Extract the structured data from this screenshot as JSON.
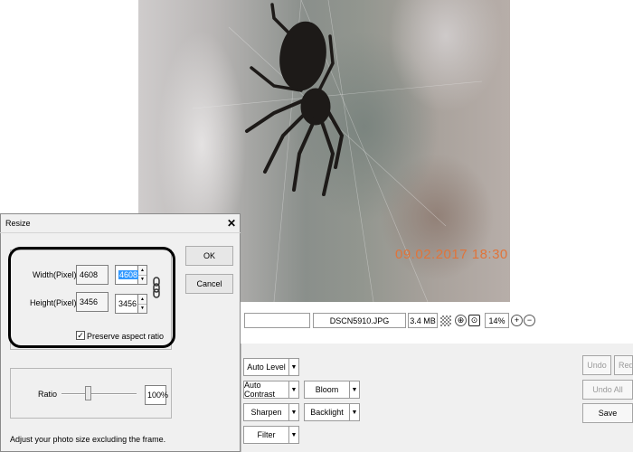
{
  "photo": {
    "date_stamp": "09.02.2017 18:30"
  },
  "status_bar": {
    "file_name": "DSCN5910.JPG",
    "file_size": "3.4 MB",
    "zoom": "14%"
  },
  "tools": {
    "auto_level": "Auto Level",
    "auto_contrast": "Auto Contrast",
    "sharpen": "Sharpen",
    "filter": "Filter",
    "bloom": "Bloom",
    "backlight": "Backlight",
    "undo": "Undo",
    "redo": "Redo",
    "undo_all": "Undo All",
    "save": "Save"
  },
  "dialog": {
    "title": "Resize",
    "width_label": "Width(Pixel)",
    "height_label": "Height(Pixel)",
    "orig_width": "4608",
    "orig_height": "3456",
    "new_width": "4608",
    "new_height": "3456",
    "preserve_label": "Preserve aspect ratio",
    "preserve_checked": true,
    "ratio_label": "Ratio",
    "ratio_value": "100%",
    "ok": "OK",
    "cancel": "Cancel",
    "hint": "Adjust your photo size excluding the frame."
  },
  "colors": {
    "date_stamp": "#e0743a",
    "selection": "#3399ff"
  }
}
